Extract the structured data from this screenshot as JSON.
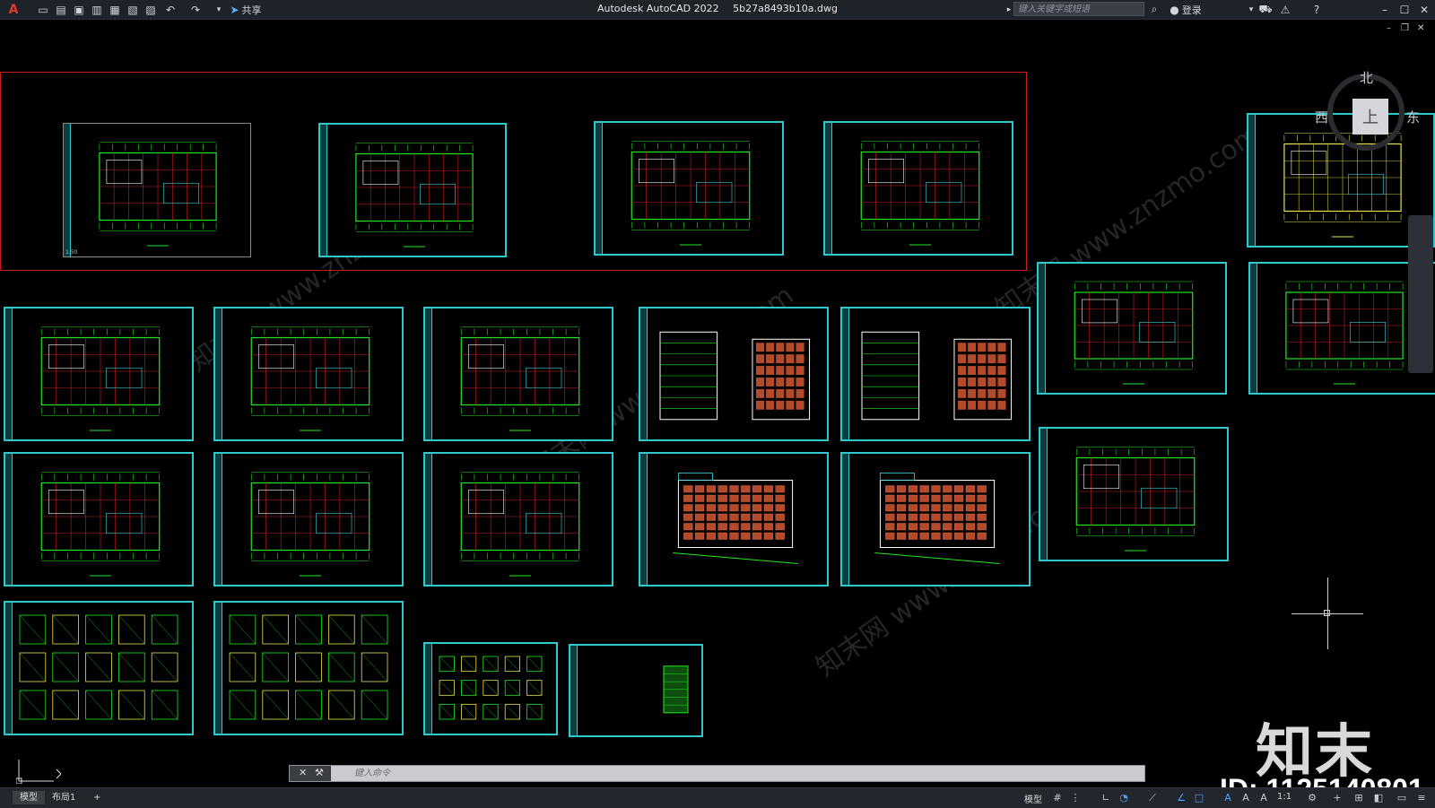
{
  "titlebar": {
    "app_name": "Autodesk AutoCAD 2022",
    "file_name": "5b27a8493b10a.dwg",
    "share_label": "共享",
    "search_placeholder": "键入关键字或短语",
    "login_label": "登录"
  },
  "viewcube": {
    "north": "北",
    "west": "西",
    "east": "东",
    "top": "上"
  },
  "command_line": {
    "placeholder": "键入命令"
  },
  "layout_tabs": [
    {
      "label": "模型",
      "active": true
    },
    {
      "label": "布局1",
      "active": false
    }
  ],
  "statusbar": {
    "model_label": "模型",
    "scale": "1:1"
  },
  "sheet_labels": {
    "scale_note": "1:50"
  },
  "watermark": {
    "brand": "知末",
    "id_text": "ID: 1125140801",
    "diagonal": "知末网 www.znzmo.com"
  },
  "colors": {
    "sheet_border": "#2fc8cc",
    "drawing_line": "#22e622",
    "grid_red": "#c81e1e",
    "facade_brick": "#b54a2a",
    "frame_red": "#c81e1e"
  }
}
